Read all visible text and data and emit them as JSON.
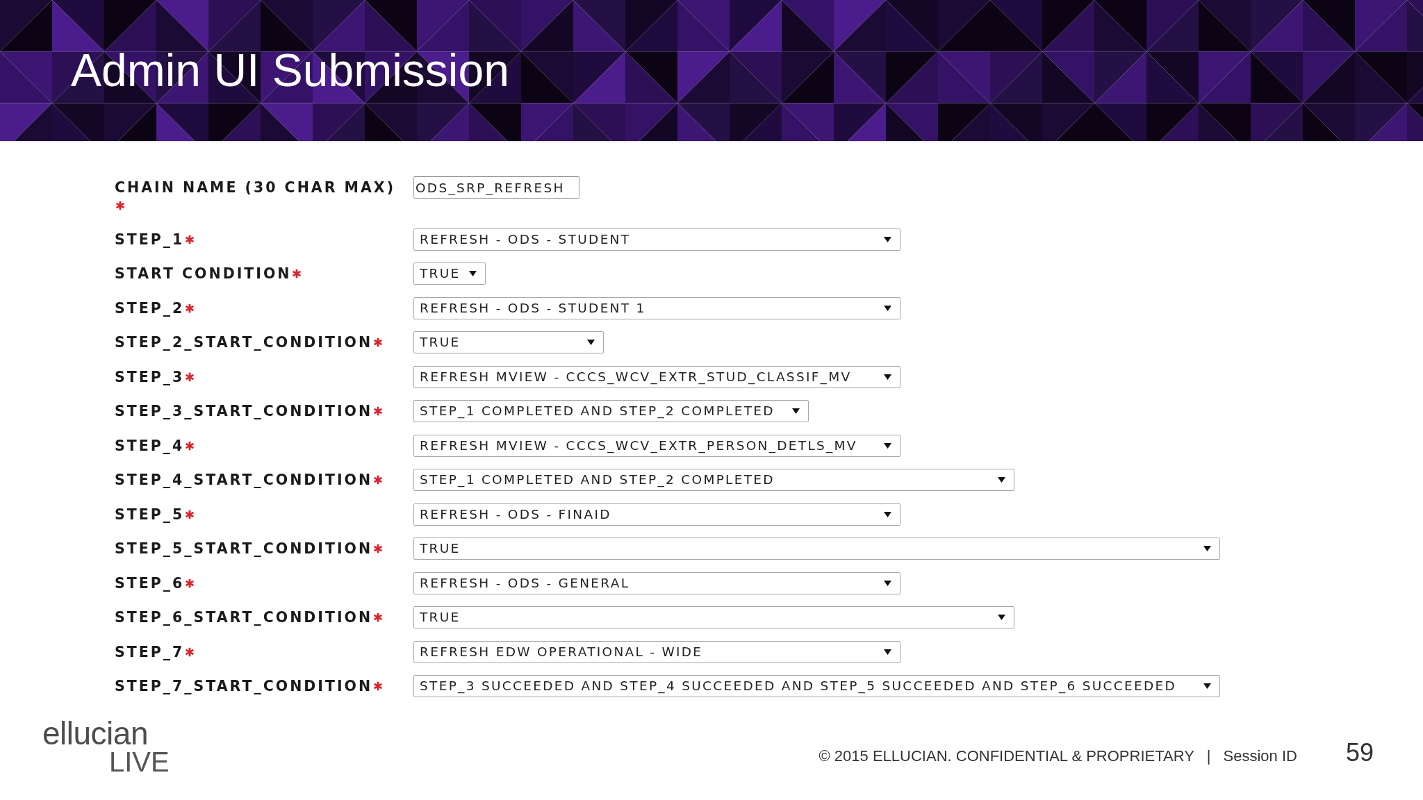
{
  "slide": {
    "title": "Admin UI Submission"
  },
  "form": {
    "fields": [
      {
        "label": "CHAIN NAME (30 CHAR MAX)",
        "required": true,
        "kind": "text",
        "value": "ODS_SRP_REFRESH"
      },
      {
        "label": "STEP_1",
        "required": true,
        "kind": "select",
        "value": "REFRESH - ODS - STUDENT"
      },
      {
        "label": "START CONDITION",
        "required": true,
        "kind": "select",
        "value": "TRUE"
      },
      {
        "label": "STEP_2",
        "required": true,
        "kind": "select",
        "value": "REFRESH - ODS - STUDENT 1"
      },
      {
        "label": "STEP_2_START_CONDITION",
        "required": true,
        "kind": "select",
        "value": "TRUE"
      },
      {
        "label": "STEP_3",
        "required": true,
        "kind": "select",
        "value": "REFRESH MVIEW - CCCS_WCV_EXTR_STUD_CLASSIF_MV"
      },
      {
        "label": "STEP_3_START_CONDITION",
        "required": true,
        "kind": "select",
        "value": "STEP_1 COMPLETED AND STEP_2 COMPLETED"
      },
      {
        "label": "STEP_4",
        "required": true,
        "kind": "select",
        "value": "REFRESH MVIEW - CCCS_WCV_EXTR_PERSON_DETLS_MV"
      },
      {
        "label": "STEP_4_START_CONDITION",
        "required": true,
        "kind": "select",
        "value": "STEP_1 COMPLETED AND STEP_2 COMPLETED"
      },
      {
        "label": "STEP_5",
        "required": true,
        "kind": "select",
        "value": "REFRESH - ODS - FINAID"
      },
      {
        "label": "STEP_5_START_CONDITION",
        "required": true,
        "kind": "select",
        "value": "TRUE"
      },
      {
        "label": "STEP_6",
        "required": true,
        "kind": "select",
        "value": "REFRESH - ODS - GENERAL"
      },
      {
        "label": "STEP_6_START_CONDITION",
        "required": true,
        "kind": "select",
        "value": "TRUE"
      },
      {
        "label": "STEP_7",
        "required": true,
        "kind": "select",
        "value": "REFRESH EDW OPERATIONAL - WIDE"
      },
      {
        "label": "STEP_7_START_CONDITION",
        "required": true,
        "kind": "select",
        "value": "STEP_3 SUCCEEDED AND STEP_4 SUCCEEDED AND STEP_5 SUCCEEDED AND STEP_6 SUCCEEDED"
      }
    ]
  },
  "footer": {
    "logo": {
      "name": "ellucian",
      "subtitle": "LIVE"
    },
    "copyright": "© 2015 ELLUCIAN. CONFIDENTIAL & PROPRIETARY",
    "separator": "|",
    "session": "Session ID",
    "page_number": "59"
  }
}
